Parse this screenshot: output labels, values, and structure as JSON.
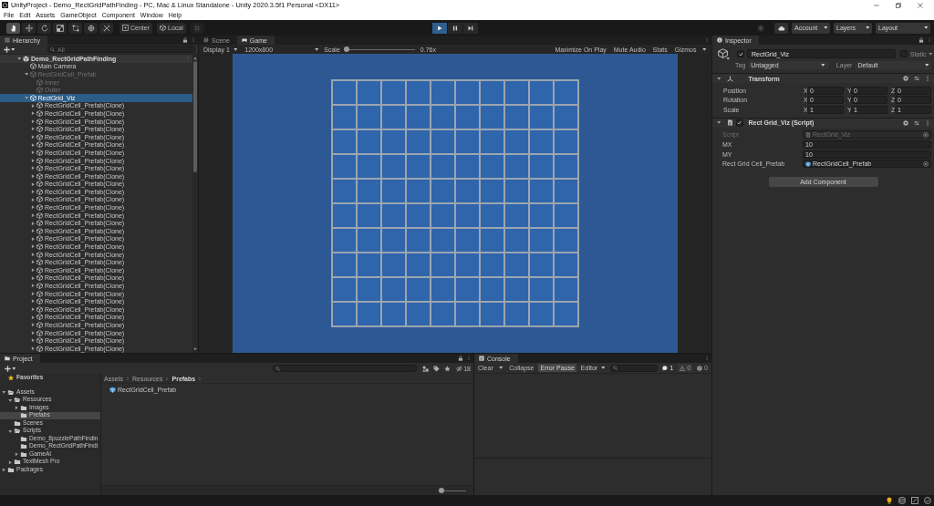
{
  "window": {
    "title": "UnityProject - Demo_RectGridPathFinding - PC, Mac & Linux Standalone - Unity 2020.3.5f1 Personal <DX11>"
  },
  "menu": [
    "File",
    "Edit",
    "Assets",
    "GameObject",
    "Component",
    "Window",
    "Help"
  ],
  "toolbar": {
    "tools": [
      {
        "kind": "hand",
        "selected": true
      },
      {
        "kind": "move",
        "selected": false
      },
      {
        "kind": "rotate",
        "selected": false
      },
      {
        "kind": "scale",
        "selected": false
      },
      {
        "kind": "rect",
        "selected": false
      },
      {
        "kind": "transform",
        "selected": false
      },
      {
        "kind": "custom",
        "selected": false
      }
    ],
    "pivot": [
      {
        "kind": "center",
        "label": "Center"
      },
      {
        "kind": "local",
        "label": "Local"
      }
    ],
    "snap": {
      "disabled": true
    },
    "play": [
      {
        "kind": "play",
        "on": true
      },
      {
        "kind": "pause",
        "on": false
      },
      {
        "kind": "step",
        "on": false
      }
    ],
    "dropdowns": [
      "Account",
      "Layers",
      "Layout"
    ]
  },
  "hierarchy": {
    "tab": "Hierarchy",
    "search_placeholder": "All",
    "items": [
      {
        "label": "Demo_RectGridPathFinding",
        "kind": "scene",
        "expanded": true,
        "selected": false,
        "disabled": false,
        "children": [
          {
            "label": "Main Camera",
            "kind": "object",
            "selected": false,
            "disabled": false
          },
          {
            "label": "RectGridCell_Prefab",
            "kind": "object",
            "expanded": true,
            "selected": false,
            "disabled": true,
            "children": [
              {
                "label": "Inner",
                "kind": "object",
                "selected": false,
                "disabled": true
              },
              {
                "label": "Outer",
                "kind": "object",
                "selected": false,
                "disabled": true
              }
            ]
          },
          {
            "label": "RectGrid_Viz",
            "kind": "object",
            "expanded": true,
            "selected": true,
            "disabled": false,
            "children": [
              {
                "label": "RectGridCell_Prefab(Clone)",
                "kind": "object",
                "expanded": false,
                "selected": false,
                "disabled": false
              },
              {
                "label": "RectGridCell_Prefab(Clone)",
                "kind": "object",
                "expanded": false,
                "selected": false,
                "disabled": false
              },
              {
                "label": "RectGridCell_Prefab(Clone)",
                "kind": "object",
                "expanded": false,
                "selected": false,
                "disabled": false
              },
              {
                "label": "RectGridCell_Prefab(Clone)",
                "kind": "object",
                "expanded": false,
                "selected": false,
                "disabled": false
              },
              {
                "label": "RectGridCell_Prefab(Clone)",
                "kind": "object",
                "expanded": false,
                "selected": false,
                "disabled": false
              },
              {
                "label": "RectGridCell_Prefab(Clone)",
                "kind": "object",
                "expanded": false,
                "selected": false,
                "disabled": false
              },
              {
                "label": "RectGridCell_Prefab(Clone)",
                "kind": "object",
                "expanded": false,
                "selected": false,
                "disabled": false
              },
              {
                "label": "RectGridCell_Prefab(Clone)",
                "kind": "object",
                "expanded": false,
                "selected": false,
                "disabled": false
              },
              {
                "label": "RectGridCell_Prefab(Clone)",
                "kind": "object",
                "expanded": false,
                "selected": false,
                "disabled": false
              },
              {
                "label": "RectGridCell_Prefab(Clone)",
                "kind": "object",
                "expanded": false,
                "selected": false,
                "disabled": false
              },
              {
                "label": "RectGridCell_Prefab(Clone)",
                "kind": "object",
                "expanded": false,
                "selected": false,
                "disabled": false
              },
              {
                "label": "RectGridCell_Prefab(Clone)",
                "kind": "object",
                "expanded": false,
                "selected": false,
                "disabled": false
              },
              {
                "label": "RectGridCell_Prefab(Clone)",
                "kind": "object",
                "expanded": false,
                "selected": false,
                "disabled": false
              },
              {
                "label": "RectGridCell_Prefab(Clone)",
                "kind": "object",
                "expanded": false,
                "selected": false,
                "disabled": false
              },
              {
                "label": "RectGridCell_Prefab(Clone)",
                "kind": "object",
                "expanded": false,
                "selected": false,
                "disabled": false
              },
              {
                "label": "RectGridCell_Prefab(Clone)",
                "kind": "object",
                "expanded": false,
                "selected": false,
                "disabled": false
              },
              {
                "label": "RectGridCell_Prefab(Clone)",
                "kind": "object",
                "expanded": false,
                "selected": false,
                "disabled": false
              },
              {
                "label": "RectGridCell_Prefab(Clone)",
                "kind": "object",
                "expanded": false,
                "selected": false,
                "disabled": false
              },
              {
                "label": "RectGridCell_Prefab(Clone)",
                "kind": "object",
                "expanded": false,
                "selected": false,
                "disabled": false
              },
              {
                "label": "RectGridCell_Prefab(Clone)",
                "kind": "object",
                "expanded": false,
                "selected": false,
                "disabled": false
              },
              {
                "label": "RectGridCell_Prefab(Clone)",
                "kind": "object",
                "expanded": false,
                "selected": false,
                "disabled": false
              },
              {
                "label": "RectGridCell_Prefab(Clone)",
                "kind": "object",
                "expanded": false,
                "selected": false,
                "disabled": false
              },
              {
                "label": "RectGridCell_Prefab(Clone)",
                "kind": "object",
                "expanded": false,
                "selected": false,
                "disabled": false
              },
              {
                "label": "RectGridCell_Prefab(Clone)",
                "kind": "object",
                "expanded": false,
                "selected": false,
                "disabled": false
              },
              {
                "label": "RectGridCell_Prefab(Clone)",
                "kind": "object",
                "expanded": false,
                "selected": false,
                "disabled": false
              },
              {
                "label": "RectGridCell_Prefab(Clone)",
                "kind": "object",
                "expanded": false,
                "selected": false,
                "disabled": false
              },
              {
                "label": "RectGridCell_Prefab(Clone)",
                "kind": "object",
                "expanded": false,
                "selected": false,
                "disabled": false
              },
              {
                "label": "RectGridCell_Prefab(Clone)",
                "kind": "object",
                "expanded": false,
                "selected": false,
                "disabled": false
              },
              {
                "label": "RectGridCell_Prefab(Clone)",
                "kind": "object",
                "expanded": false,
                "selected": false,
                "disabled": false
              },
              {
                "label": "RectGridCell_Prefab(Clone)",
                "kind": "object",
                "expanded": false,
                "selected": false,
                "disabled": false
              },
              {
                "label": "RectGridCell_Prefab(Clone)",
                "kind": "object",
                "expanded": false,
                "selected": false,
                "disabled": false
              },
              {
                "label": "RectGridCell_Prefab(Clone)",
                "kind": "object",
                "expanded": false,
                "selected": false,
                "disabled": false
              }
            ]
          }
        ]
      }
    ]
  },
  "game": {
    "tabs": [
      {
        "label": "Scene",
        "kind": "scene",
        "selected": false
      },
      {
        "label": "Game",
        "kind": "game",
        "selected": true
      }
    ],
    "display": "Display 1",
    "resolution": "1200x800",
    "scale_label": "Scale",
    "scale_slider": {
      "level": 0
    },
    "scale_reading": "0.76x",
    "toggles": [
      {
        "label": "Maximize On Play",
        "on": false
      },
      {
        "label": "Mute Audio",
        "on": false
      },
      {
        "label": "Stats",
        "on": false
      }
    ],
    "gizmos": "Gizmos"
  },
  "inspector": {
    "tab": "Inspector",
    "object": {
      "active": true,
      "name": "RectGrid_Viz",
      "static": false,
      "static_label": "Static",
      "tag_label": "Tag",
      "tag": "Untagged",
      "layer_label": "Layer",
      "layer": "Default"
    },
    "components": [
      {
        "kind": "transform",
        "title": "Transform",
        "expanded": true,
        "rows": [
          {
            "label": "Position",
            "values": [
              {
                "axis": "X",
                "value": "0"
              },
              {
                "axis": "Y",
                "value": "0"
              },
              {
                "axis": "Z",
                "value": "0"
              }
            ]
          },
          {
            "label": "Rotation",
            "values": [
              {
                "axis": "X",
                "value": "0"
              },
              {
                "axis": "Y",
                "value": "0"
              },
              {
                "axis": "Z",
                "value": "0"
              }
            ]
          },
          {
            "label": "Scale",
            "values": [
              {
                "axis": "X",
                "value": "1"
              },
              {
                "axis": "Y",
                "value": "1"
              },
              {
                "axis": "Z",
                "value": "1"
              }
            ]
          }
        ]
      },
      {
        "kind": "script",
        "title": "Rect Grid_Viz (Script)",
        "expanded": true,
        "enabled": true,
        "fields": [
          {
            "label": "Script",
            "kind": "script",
            "value": "RectGrid_Viz",
            "disabled": true
          },
          {
            "label": "MX",
            "kind": "number",
            "value": "10",
            "disabled": false
          },
          {
            "label": "MY",
            "kind": "number",
            "value": "10",
            "disabled": false
          },
          {
            "label": "Rect Grid Cell_Prefab",
            "kind": "prefab",
            "value": "RectGridCell_Prefab",
            "disabled": false
          }
        ]
      }
    ],
    "add_button": "Add Component"
  },
  "project": {
    "tab": "Project",
    "hidden_packages": "18",
    "tree": [
      {
        "label": "Favorites",
        "kind": "favorites",
        "selected": false
      },
      {
        "label": "Assets",
        "kind": "folder",
        "expanded": true,
        "selected": false,
        "children": [
          {
            "label": "Resources",
            "kind": "folder",
            "expanded": true,
            "selected": false,
            "children": [
              {
                "label": "Images",
                "kind": "folder",
                "expanded": false,
                "selected": false
              },
              {
                "label": "Prefabs",
                "kind": "folder",
                "selected": true
              }
            ]
          },
          {
            "label": "Scenes",
            "kind": "folder",
            "selected": false
          },
          {
            "label": "Scripts",
            "kind": "folder",
            "expanded": true,
            "selected": false,
            "children": [
              {
                "label": "Demo_8puzzlePathFindin",
                "kind": "folder",
                "selected": false
              },
              {
                "label": "Demo_RectGridPathFindi",
                "kind": "folder",
                "selected": false
              },
              {
                "label": "GameAI",
                "kind": "folder",
                "expanded": false,
                "selected": false
              }
            ]
          },
          {
            "label": "TextMesh Pro",
            "kind": "folder",
            "expanded": false,
            "selected": false
          }
        ]
      },
      {
        "label": "Packages",
        "kind": "folder",
        "expanded": false,
        "selected": false
      }
    ],
    "breadcrumb": [
      {
        "label": "Assets",
        "current": false
      },
      {
        "label": "Resources",
        "current": false
      },
      {
        "label": "Prefabs",
        "current": true
      }
    ],
    "items": [
      {
        "label": "RectGridCell_Prefab",
        "kind": "prefab"
      }
    ],
    "size_slider": {
      "level": 0
    }
  },
  "console": {
    "tab": "Console",
    "clear": "Clear",
    "toggles": [
      {
        "label": "Collapse",
        "on": false
      },
      {
        "label": "Error Pause",
        "on": true
      }
    ],
    "editor": "Editor",
    "counts": [
      {
        "kind": "info",
        "count": "1"
      },
      {
        "kind": "warning",
        "count": "0"
      },
      {
        "kind": "error",
        "count": "0"
      }
    ]
  }
}
